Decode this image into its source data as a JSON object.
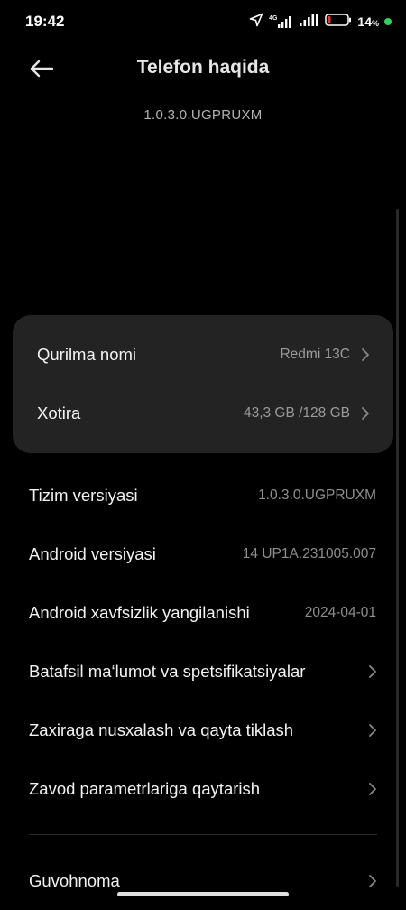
{
  "status_bar": {
    "time": "19:42",
    "network": "4G",
    "battery_percent": "14",
    "battery_unit": "%"
  },
  "header": {
    "title": "Telefon haqida",
    "version": "1.0.3.0.UGPRUXM"
  },
  "card": {
    "items": [
      {
        "label": "Qurilma nomi",
        "value": "Redmi 13C"
      },
      {
        "label": "Xotira",
        "value": "43,3 GB /128 GB"
      }
    ]
  },
  "info": {
    "items": [
      {
        "label": "Tizim versiyasi",
        "value": "1.0.3.0.UGPRUXM"
      },
      {
        "label": "Android versiyasi",
        "value": "14 UP1A.231005.007"
      },
      {
        "label": "Android xavfsizlik yangilanishi",
        "value": "2024-04-01"
      }
    ]
  },
  "links": {
    "items": [
      {
        "label": "Batafsil ma‘lumot va spetsifikatsiyalar"
      },
      {
        "label": "Zaxiraga nusxalash va qayta tiklash"
      },
      {
        "label": "Zavod parametrlariga qaytarish"
      },
      {
        "label": "Guvohnoma"
      }
    ]
  },
  "colors": {
    "background": "#000000",
    "card": "#232323",
    "battery_low": "#e53935",
    "charging_dot": "#2fd35b"
  }
}
